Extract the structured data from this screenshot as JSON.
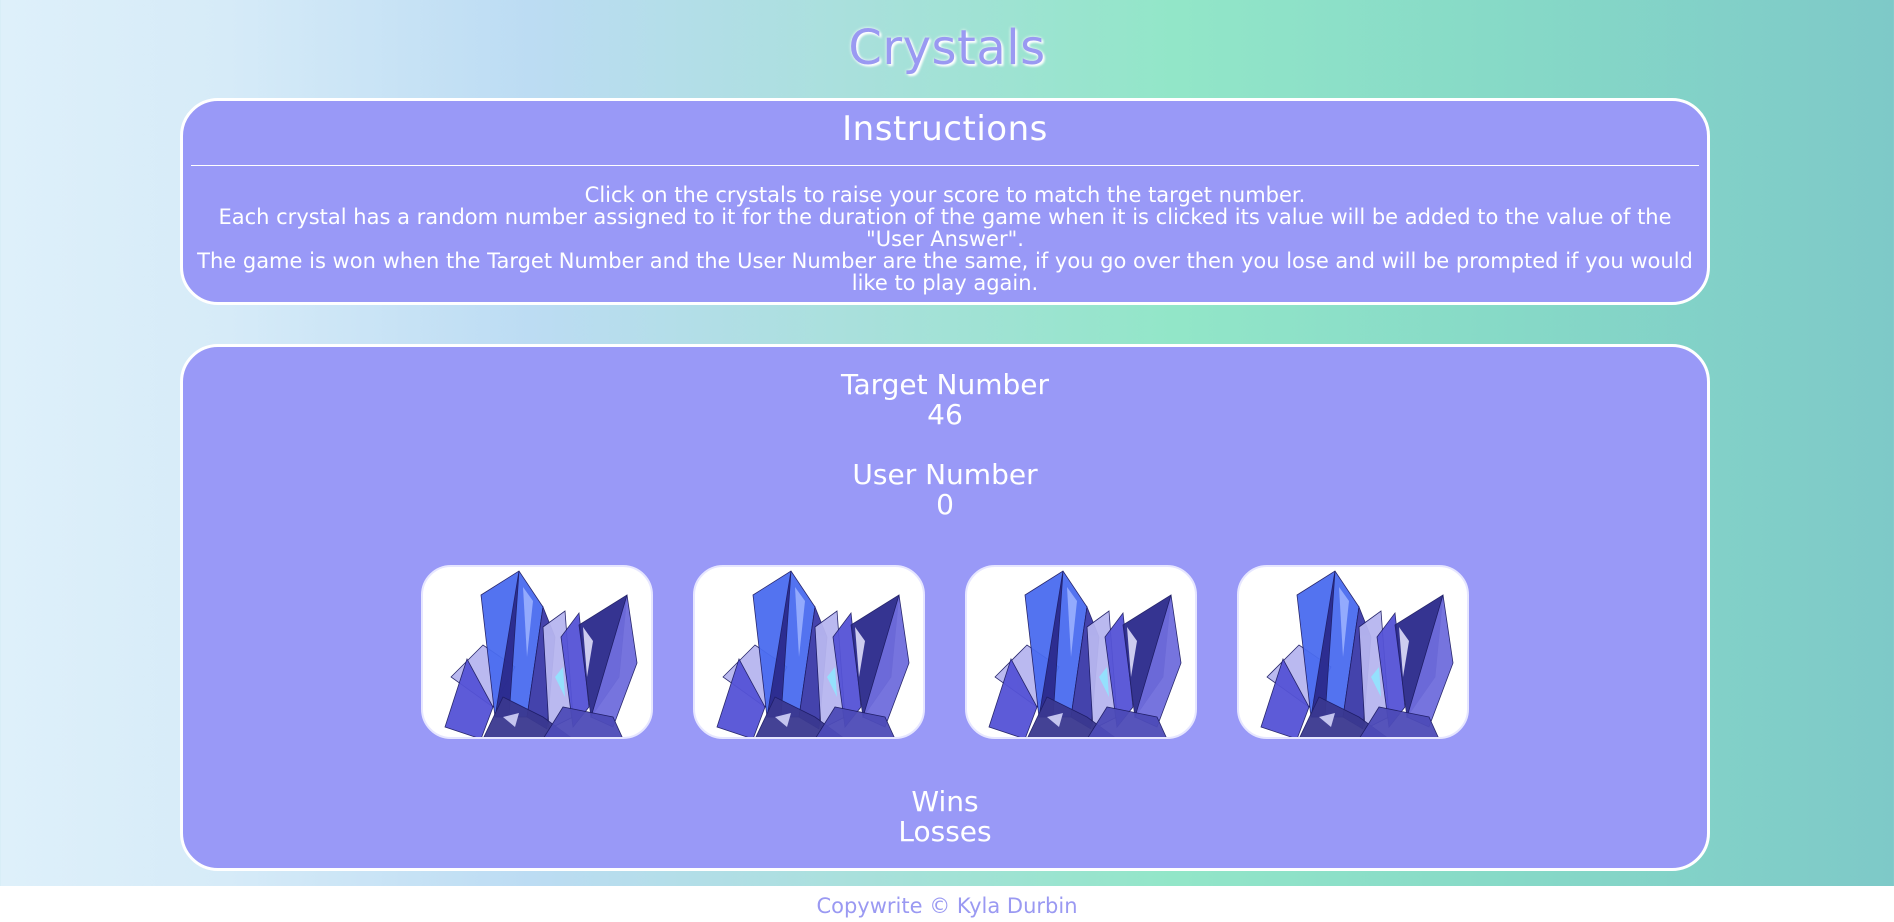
{
  "header": {
    "title": "Crystals"
  },
  "instructions": {
    "heading": "Instructions",
    "lines": [
      "Click on the crystals to raise your score to match the target number.",
      "Each crystal has a random number assigned to it for the duration of the game when it is clicked its value will be added to the value of the \"User Answer\".",
      "The game is won when the Target Number and the User Number are the same, if you go over then you lose and will be prompted if you would like to play again."
    ]
  },
  "game": {
    "target_label": "Target Number",
    "target_value": "46",
    "user_label": "User Number",
    "user_value": "0",
    "crystals": [
      {
        "icon": "crystal-icon"
      },
      {
        "icon": "crystal-icon"
      },
      {
        "icon": "crystal-icon"
      },
      {
        "icon": "crystal-icon"
      }
    ],
    "wins_label": "Wins",
    "losses_label": "Losses"
  },
  "footer": {
    "text": "Copywrite © Kyla Durbin"
  },
  "colors": {
    "panel": "#9999f7",
    "title": "#9a99f2",
    "border": "#ffffff",
    "crystal_dark": "#2b2a8c",
    "crystal_mid": "#5553d6",
    "crystal_light": "#b7b6f0",
    "crystal_blue": "#4a6cf0"
  }
}
